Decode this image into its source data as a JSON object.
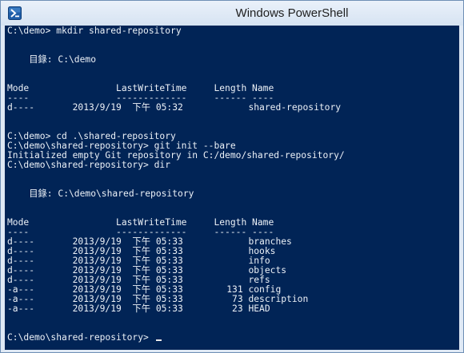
{
  "window": {
    "title": "Windows PowerShell"
  },
  "console": {
    "lines": [
      "C:\\demo> mkdir shared-repository",
      "",
      "",
      "    目錄: C:\\demo",
      "",
      "",
      "Mode                LastWriteTime     Length Name",
      "----                -------------     ------ ----",
      "d----       2013/9/19  下午 05:32            shared-repository",
      "",
      "",
      "C:\\demo> cd .\\shared-repository",
      "C:\\demo\\shared-repository> git init --bare",
      "Initialized empty Git repository in C:/demo/shared-repository/",
      "C:\\demo\\shared-repository> dir",
      "",
      "",
      "    目錄: C:\\demo\\shared-repository",
      "",
      "",
      "Mode                LastWriteTime     Length Name",
      "----                -------------     ------ ----",
      "d----       2013/9/19  下午 05:33            branches",
      "d----       2013/9/19  下午 05:33            hooks",
      "d----       2013/9/19  下午 05:33            info",
      "d----       2013/9/19  下午 05:33            objects",
      "d----       2013/9/19  下午 05:33            refs",
      "-a---       2013/9/19  下午 05:33        131 config",
      "-a---       2013/9/19  下午 05:33         73 description",
      "-a---       2013/9/19  下午 05:33         23 HEAD",
      "",
      "",
      "C:\\demo\\shared-repository> "
    ]
  },
  "colors": {
    "console_background": "#012456",
    "console_text": "#ecf1f7",
    "titlebar": "#dae6f4"
  },
  "icons": {
    "app": "powershell-icon"
  }
}
